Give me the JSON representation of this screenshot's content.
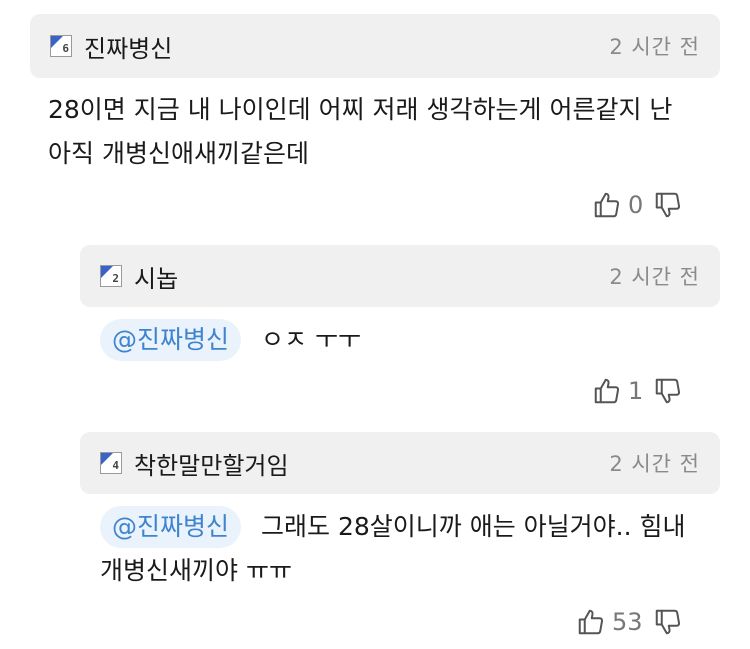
{
  "comments": [
    {
      "author": "진짜병신",
      "level": "6",
      "time": "2 시간 전",
      "text_line1": "28이면 지금 내 나이인데 어찌 저래 생각하는게 어른같지 난",
      "text_line2": "아직 개병신애새끼같은데",
      "likes": "0"
    },
    {
      "author": "시놉",
      "level": "2",
      "time": "2 시간 전",
      "mention": "@진짜병신",
      "text": "ㅇㅈ ㅜㅜ",
      "likes": "1"
    },
    {
      "author": "착한말만할거임",
      "level": "4",
      "time": "2 시간 전",
      "mention": "@진짜병신",
      "text_line1": "그래도 28살이니까 애는 아닐거야.. 힘내",
      "text_line2": "개병신새끼야 ㅠㅠ",
      "likes": "53"
    }
  ],
  "icons": {
    "like": "thumbs-up-icon",
    "dislike": "thumbs-down-icon"
  },
  "colors": {
    "header_bg": "#f0f0f0",
    "mention_bg": "#eaf3fc",
    "mention_text": "#3f84cf",
    "badge_accent": "#3a63c8"
  }
}
